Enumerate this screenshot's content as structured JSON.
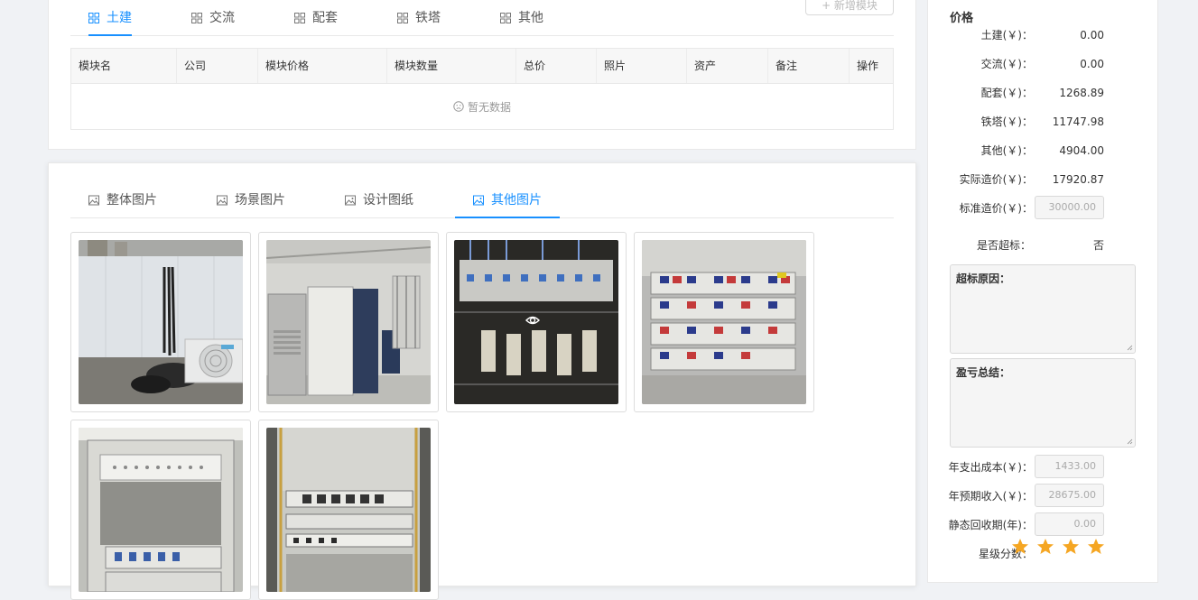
{
  "module_tabs": [
    {
      "label": "土建",
      "active": true
    },
    {
      "label": "交流",
      "active": false
    },
    {
      "label": "配套",
      "active": false
    },
    {
      "label": "铁塔",
      "active": false
    },
    {
      "label": "其他",
      "active": false
    }
  ],
  "add_module_label": "+ 新增模块",
  "table": {
    "columns": [
      "模块名",
      "公司",
      "模块价格",
      "模块数量",
      "总价",
      "照片",
      "资产",
      "备注",
      "操作"
    ],
    "empty_text": "暂无数据"
  },
  "photo_tabs": [
    {
      "label": "整体图片",
      "active": false
    },
    {
      "label": "场景图片",
      "active": false
    },
    {
      "label": "设计图纸",
      "active": false
    },
    {
      "label": "其他图片",
      "active": true
    }
  ],
  "photos": [
    {
      "subject": "outdoor wall with cables and air conditioner"
    },
    {
      "subject": "equipment room cabinets"
    },
    {
      "subject": "circuit breaker panel"
    },
    {
      "subject": "battery rack"
    },
    {
      "subject": "open equipment rack"
    },
    {
      "subject": "rack with transmission units"
    }
  ],
  "side": {
    "title": "价格",
    "prices": [
      {
        "label": "土建(￥)：",
        "value": "0.00"
      },
      {
        "label": "交流(￥)：",
        "value": "0.00"
      },
      {
        "label": "配套(￥)：",
        "value": "1268.89"
      },
      {
        "label": "铁塔(￥)：",
        "value": "11747.98"
      },
      {
        "label": "其他(￥)：",
        "value": "4904.00"
      },
      {
        "label": "实际造价(￥)：",
        "value": "17920.87"
      }
    ],
    "standard_cost": {
      "label": "标准造价(￥)：",
      "value": "30000.00"
    },
    "over_standard": {
      "label": "是否超标：",
      "value": "否"
    },
    "reason_label": "超标原因：",
    "summary_label": "盈亏总结：",
    "annual_cost": {
      "label": "年支出成本(￥)：",
      "value": "1433.00"
    },
    "annual_income": {
      "label": "年预期收入(￥)：",
      "value": "28675.00"
    },
    "payback": {
      "label": "静态回收期(年)：",
      "value": "0.00"
    },
    "rating": {
      "label": "星级分数：",
      "stars": 4
    },
    "star_color": "#f5a623"
  }
}
